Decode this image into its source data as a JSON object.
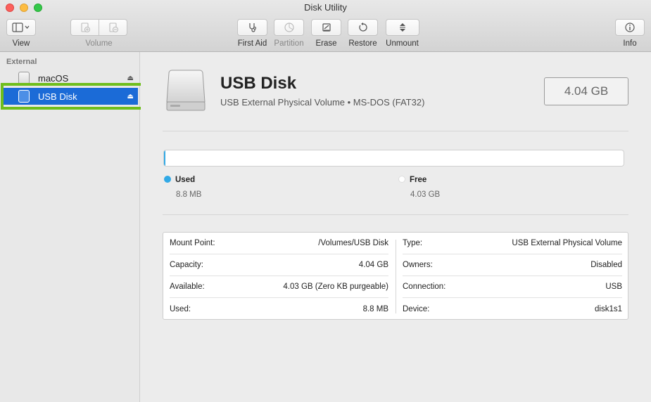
{
  "window": {
    "title": "Disk Utility"
  },
  "toolbar": {
    "view_label": "View",
    "volume_label": "Volume",
    "first_aid_label": "First Aid",
    "partition_label": "Partition",
    "erase_label": "Erase",
    "restore_label": "Restore",
    "unmount_label": "Unmount",
    "info_label": "Info"
  },
  "sidebar": {
    "section": "External",
    "items": [
      {
        "label": "macOS",
        "selected": false
      },
      {
        "label": "USB Disk",
        "selected": true
      }
    ]
  },
  "disk": {
    "name": "USB Disk",
    "subtitle": "USB External Physical Volume • MS-DOS (FAT32)",
    "capacity": "4.04 GB"
  },
  "usage": {
    "used_fraction": 0.0022,
    "used_label": "Used",
    "used_value": "8.8 MB",
    "free_label": "Free",
    "free_value": "4.03 GB",
    "used_color": "#31a9e6",
    "free_color": "#ffffff"
  },
  "details": {
    "left": [
      {
        "label": "Mount Point:",
        "value": "/Volumes/USB Disk"
      },
      {
        "label": "Capacity:",
        "value": "4.04 GB"
      },
      {
        "label": "Available:",
        "value": "4.03 GB (Zero KB purgeable)"
      },
      {
        "label": "Used:",
        "value": "8.8 MB"
      }
    ],
    "right": [
      {
        "label": "Type:",
        "value": "USB External Physical Volume"
      },
      {
        "label": "Owners:",
        "value": "Disabled"
      },
      {
        "label": "Connection:",
        "value": "USB"
      },
      {
        "label": "Device:",
        "value": "disk1s1"
      }
    ]
  },
  "colors": {
    "selection": "#1b6bd7",
    "highlight": "#6fbe1c"
  }
}
